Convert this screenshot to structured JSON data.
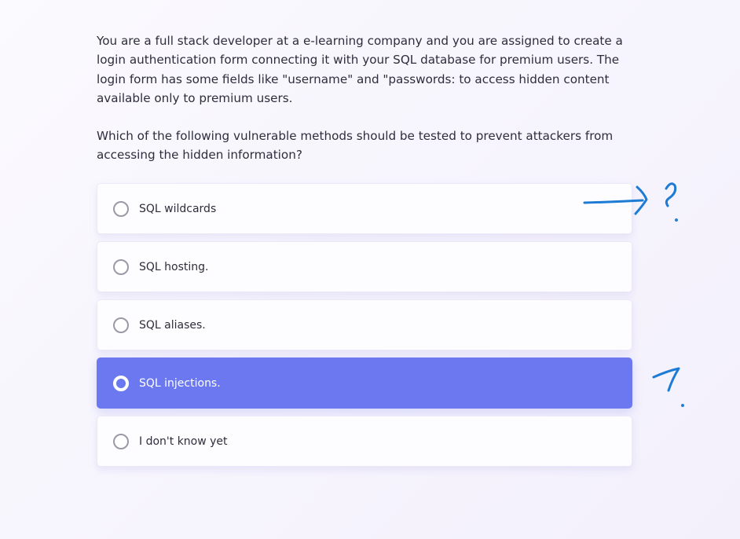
{
  "question": {
    "paragraph1": "You are a full stack developer at a e-learning company and you are assigned to create a login authentication form connecting it with your SQL database for premium users. The login form has some fields like \"username\" and \"passwords: to access hidden content available only to premium users.",
    "paragraph2": "Which of the following vulnerable methods should be tested to prevent attackers from accessing the hidden information?"
  },
  "options": [
    {
      "label": "SQL wildcards",
      "selected": false
    },
    {
      "label": "SQL hosting.",
      "selected": false
    },
    {
      "label": "SQL aliases.",
      "selected": false
    },
    {
      "label": "SQL injections.",
      "selected": true
    },
    {
      "label": "I don't know yet",
      "selected": false
    }
  ],
  "colors": {
    "selected": "#6b78ef",
    "annotation": "#1e7bd4"
  }
}
